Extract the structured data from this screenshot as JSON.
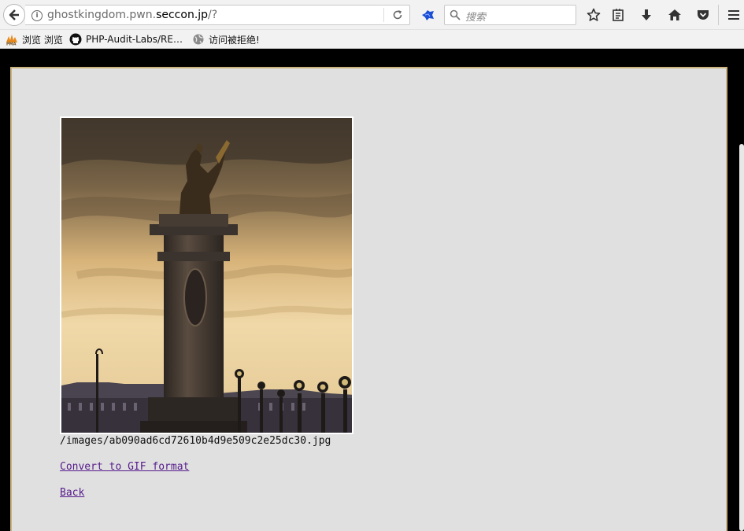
{
  "browser": {
    "url_prefix": "ghostkingdom.pwn.",
    "url_host": "seccon.jp",
    "url_suffix": "/?",
    "search_placeholder": "搜索"
  },
  "bookmarks": [
    {
      "label": "浏览 浏览",
      "icon": "pma-icon"
    },
    {
      "label": "PHP-Audit-Labs/RE…",
      "icon": "github-icon"
    },
    {
      "label": "访问被拒绝!",
      "icon": "globe-icon"
    }
  ],
  "page": {
    "image_caption": "/images/ab090ad6cd72610b4d9e509c2e25dc30.jpg",
    "convert_link": "Convert to GIF format",
    "back_link": "Back"
  },
  "colors": {
    "panel_bg": "#e0e0e0",
    "panel_border": "#c9b27c",
    "link": "#551a8b",
    "page_bg": "#000000"
  }
}
